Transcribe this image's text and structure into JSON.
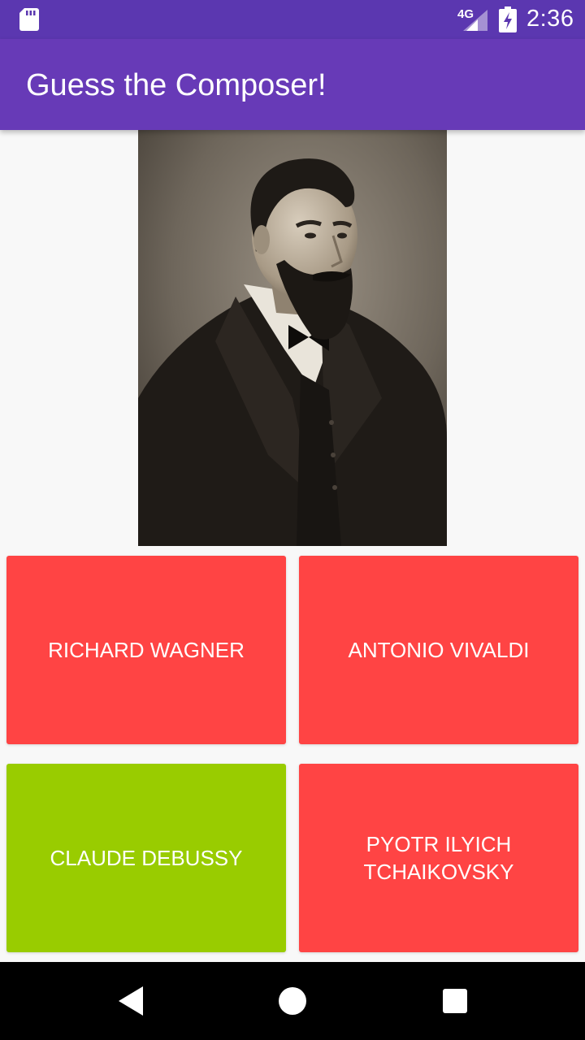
{
  "status_bar": {
    "network": "4G",
    "time": "2:36",
    "icons": [
      "sd-card-icon",
      "signal-icon",
      "battery-charging-icon"
    ]
  },
  "app_bar": {
    "title": "Guess the Composer!"
  },
  "portrait": {
    "subject": "composer-portrait-image"
  },
  "answers": [
    {
      "label": "Richard Wagner",
      "color": "#ff4444"
    },
    {
      "label": "Antonio Vivaldi",
      "color": "#ff4444"
    },
    {
      "label": "Claude Debussy",
      "color": "#99cc00"
    },
    {
      "label": "Pyotr Ilyich Tchaikovsky",
      "color": "#ff4444"
    }
  ],
  "nav_bar": {
    "icons": [
      "back-icon",
      "home-icon",
      "recents-icon"
    ]
  }
}
